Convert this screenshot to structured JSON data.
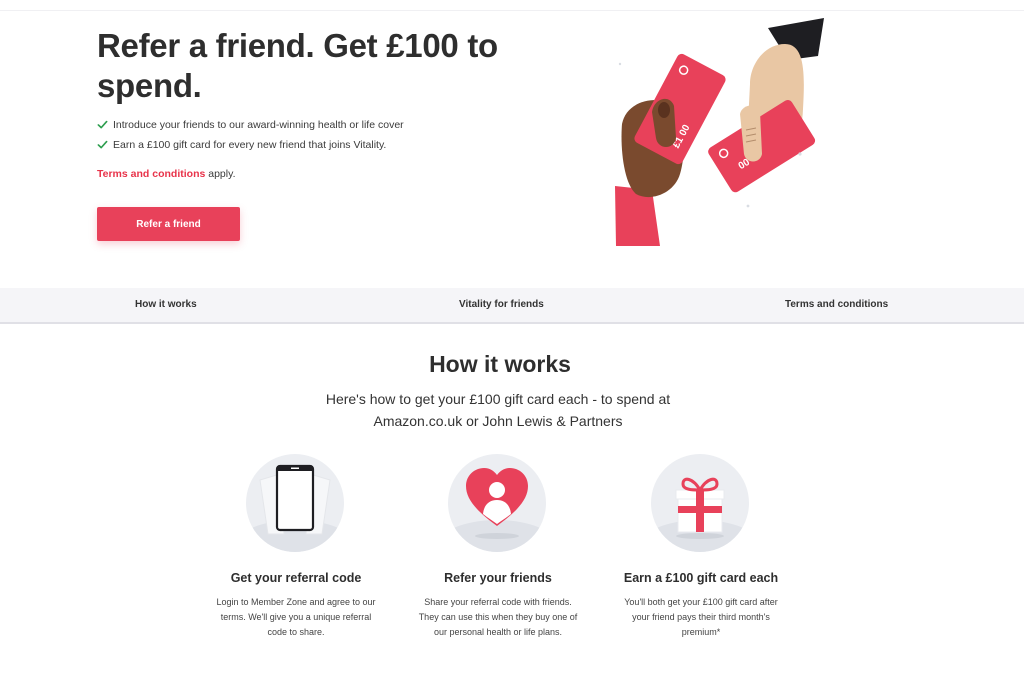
{
  "hero": {
    "title": "Refer a friend. Get £100 to spend.",
    "bullets": [
      "Introduce your friends to our award-winning health or life cover",
      "Earn a £100 gift card for every new friend that joins Vitality."
    ],
    "terms_link": "Terms and conditions",
    "terms_suffix": " apply.",
    "cta_label": "Refer a friend",
    "card_label": "£1 00"
  },
  "tabs": [
    {
      "label": "How it works"
    },
    {
      "label": "Vitality for friends"
    },
    {
      "label": "Terms and conditions"
    }
  ],
  "how_it_works": {
    "title": "How it works",
    "subtitle_line1": "Here's how to get your £100 gift card each - to spend at",
    "subtitle_line2": "Amazon.co.uk or John Lewis & Partners",
    "steps": [
      {
        "title": "Get your referral code",
        "description": "Login to Member Zone and agree to our terms. We'll give you a unique referral code to share.",
        "icon": "phone-icon"
      },
      {
        "title": "Refer your friends",
        "description": "Share your referral code with friends. They can use this when they buy one of our personal health or life plans.",
        "icon": "heart-person-icon"
      },
      {
        "title": "Earn a £100 gift card each",
        "description": "You'll both get your £100 gift card after your friend pays their third month's premium*",
        "icon": "gift-icon"
      }
    ]
  },
  "colors": {
    "accent": "#e8415a",
    "check": "#2e9e4f",
    "tab_bar": "#f5f5f8"
  }
}
